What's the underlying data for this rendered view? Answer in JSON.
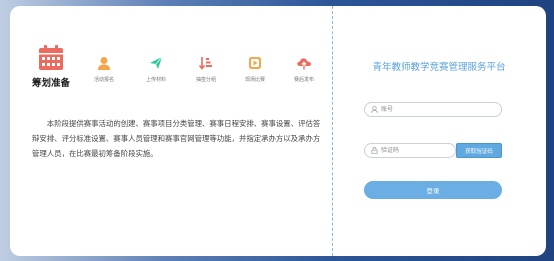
{
  "colors": {
    "accent": "#5aa2df",
    "button": "#6aaee3",
    "icon_red": "#ec6b5e",
    "icon_orange": "#f3a64a",
    "icon_green": "#2fc59a"
  },
  "stages": {
    "main": {
      "label": "筹划准备",
      "icon": "calendar-icon"
    },
    "items": [
      {
        "label": "活动报名",
        "icon": "user-icon"
      },
      {
        "label": "上传材料",
        "icon": "send-icon"
      },
      {
        "label": "抽签分组",
        "icon": "sort-icon"
      },
      {
        "label": "现场比赛",
        "icon": "play-icon"
      },
      {
        "label": "赛后发布",
        "icon": "cloud-upload-icon"
      }
    ]
  },
  "description": "本阶段提供赛事活动的创建、赛事项目分类管理、赛事日程安排、赛事设置、评估答辩安排、评分标准设置、赛事人员管理和赛事官网管理等功能，并指定承办方以及承办方管理人员，在比赛最初筹备阶段实施。",
  "login": {
    "title": "青年教师教学竞赛管理服务平台",
    "account_placeholder": "账号",
    "code_placeholder": "验证码",
    "get_code_label": "获取验证码",
    "submit_label": "登录"
  }
}
